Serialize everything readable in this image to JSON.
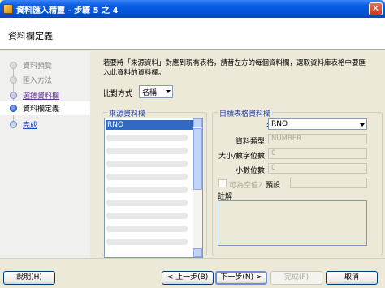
{
  "window": {
    "title": "資料匯入精靈 - 步驟 5 之 4",
    "close_glyph": "✕"
  },
  "header": {
    "title": "資料欄定義"
  },
  "nav": {
    "items": [
      {
        "label": "資料預覽"
      },
      {
        "label": "匯入方法"
      },
      {
        "label": "選擇資料欄"
      },
      {
        "label": "資料欄定義"
      },
      {
        "label": "完成"
      }
    ]
  },
  "content": {
    "instruction": "若要將「來源資料」對應到現有表格，請替左方的每個資料欄，選取資料庫表格中要匯入此資料的資料欄。",
    "compare_label": "比對方式",
    "compare_value": "名稱",
    "source_group": {
      "legend": "來源資料欄",
      "items": [
        "RNO"
      ],
      "selected": "RNO"
    },
    "target_group": {
      "legend": "目標表格資料欄",
      "name_label": "名稱",
      "name_value": "RNO",
      "type_label": "資料類型",
      "type_value": "NUMBER",
      "size_label": "大小/數字位數",
      "size_value": "0",
      "scale_label": "小數位數",
      "scale_value": "0",
      "nullable_label": "可為空值?",
      "default_label": "預設",
      "default_value": "",
      "comment_label": "註解"
    }
  },
  "footer": {
    "help": "說明(H)",
    "back": "< 上一步(B)",
    "next": "下一步(N) >",
    "finish": "完成(F)",
    "cancel": "取消"
  },
  "colors": {
    "title_bar": "#0553d8",
    "selection": "#316ac5",
    "group_legend": "#1f3ea0",
    "window_bg": "#ece9d8"
  },
  "icons": [
    "app-icon",
    "close-icon",
    "dropdown-arrow-icon",
    "scroll-up-icon",
    "scroll-down-icon"
  ]
}
